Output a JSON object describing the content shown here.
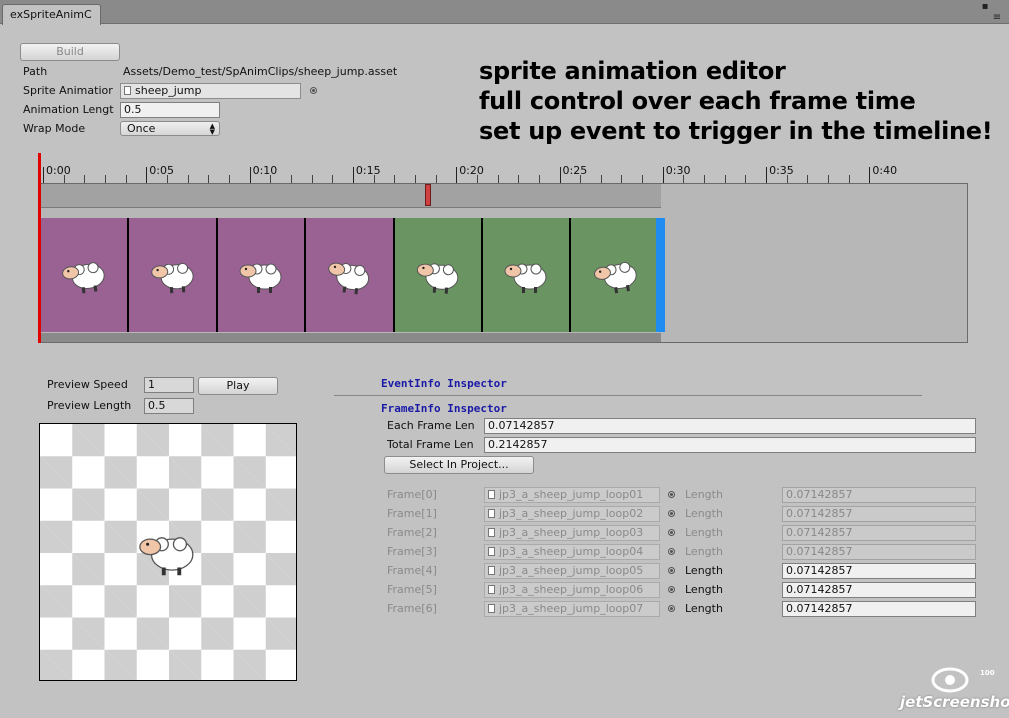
{
  "window": {
    "tab_title": "exSpriteAnimC"
  },
  "toolbar": {
    "build_label": "Build"
  },
  "props": {
    "path_label": "Path",
    "path_value": "Assets/Demo_test/SpAnimClips/sheep_jump.asset",
    "sprite_label": "Sprite Animatior",
    "sprite_value": "sheep_jump",
    "length_label": "Animation Lengt",
    "length_value": "0.5",
    "wrap_label": "Wrap Mode",
    "wrap_value": "Once"
  },
  "overlay_text": [
    "sprite animation editor",
    "full control over each frame time",
    "set up event to trigger in the timeline!"
  ],
  "timeline": {
    "ticks": [
      "0:00",
      "0:05",
      "0:10",
      "0:15",
      "0:20",
      "0:25",
      "0:30",
      "0:35",
      "0:40"
    ],
    "frames": [
      {
        "color": "#9a6193"
      },
      {
        "color": "#9a6193"
      },
      {
        "color": "#9a6193"
      },
      {
        "color": "#9a6193"
      },
      {
        "color": "#6b9463"
      },
      {
        "color": "#6b9463"
      },
      {
        "color": "#6b9463"
      }
    ],
    "end_marker_color": "#1e8cf0",
    "event_marker_color": "#d04040",
    "cursor_color": "#e00000"
  },
  "preview": {
    "speed_label": "Preview Speed",
    "speed_value": "1",
    "play_label": "Play",
    "length_label": "Preview Length",
    "length_value": "0.5"
  },
  "event_inspector": {
    "title": "EventInfo Inspector"
  },
  "frame_inspector": {
    "title": "FrameInfo Inspector",
    "each_len_label": "Each Frame Len",
    "each_len_value": "0.07142857",
    "total_len_label": "Total Frame Len",
    "total_len_value": "0.2142857",
    "select_label": "Select In Project...",
    "length_label": "Length",
    "rows": [
      {
        "label": "Frame[0]",
        "asset": "jp3_a_sheep_jump_loop01",
        "length": "0.07142857",
        "enabled": false
      },
      {
        "label": "Frame[1]",
        "asset": "jp3_a_sheep_jump_loop02",
        "length": "0.07142857",
        "enabled": false
      },
      {
        "label": "Frame[2]",
        "asset": "jp3_a_sheep_jump_loop03",
        "length": "0.07142857",
        "enabled": false
      },
      {
        "label": "Frame[3]",
        "asset": "jp3_a_sheep_jump_loop04",
        "length": "0.07142857",
        "enabled": false
      },
      {
        "label": "Frame[4]",
        "asset": "jp3_a_sheep_jump_loop05",
        "length": "0.07142857",
        "enabled": true
      },
      {
        "label": "Frame[5]",
        "asset": "jp3_a_sheep_jump_loop06",
        "length": "0.07142857",
        "enabled": true
      },
      {
        "label": "Frame[6]",
        "asset": "jp3_a_sheep_jump_loop07",
        "length": "0.07142857",
        "enabled": true
      }
    ]
  },
  "watermark": {
    "brand": "jetScreenshot",
    "badge": "100"
  }
}
